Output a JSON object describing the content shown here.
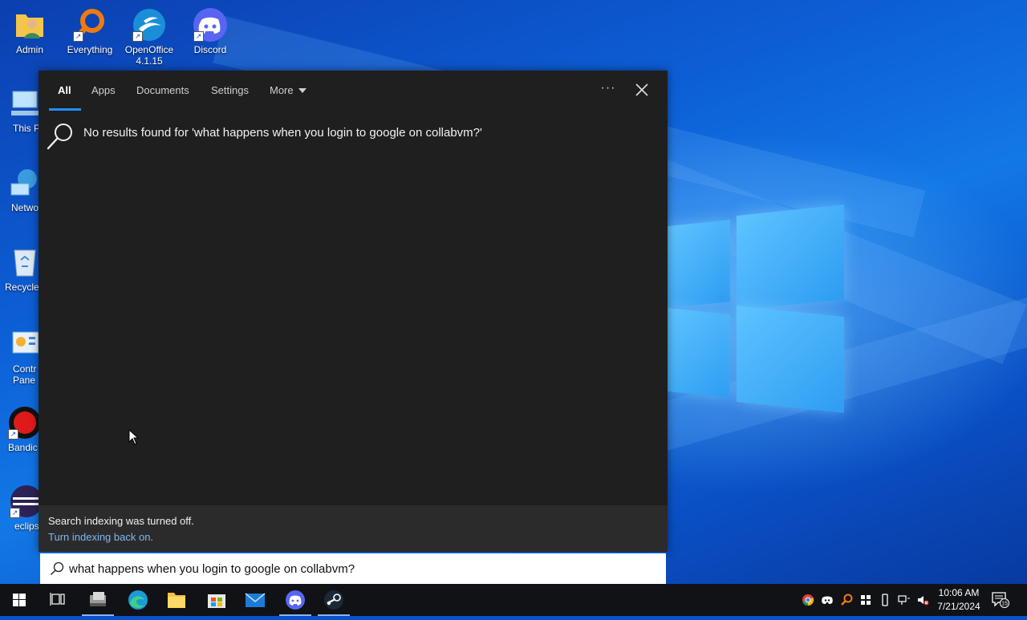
{
  "desktop": {
    "icons": [
      {
        "label": "Admin"
      },
      {
        "label": "Everything"
      },
      {
        "label": "OpenOffice\n4.1.15"
      },
      {
        "label": "Discord"
      },
      {
        "label": "This P"
      },
      {
        "label": "Netwo"
      },
      {
        "label": "Recycle"
      },
      {
        "label": "Contr\nPane"
      },
      {
        "label": "Bandic"
      },
      {
        "label": "eclips"
      }
    ]
  },
  "search": {
    "tabs": [
      {
        "label": "All"
      },
      {
        "label": "Apps"
      },
      {
        "label": "Documents"
      },
      {
        "label": "Settings"
      },
      {
        "label": "More"
      }
    ],
    "ellipsis": "···",
    "no_results": "No results found for 'what happens when you login to google on collabvm?'",
    "indexing_message": "Search indexing was turned off.",
    "indexing_link": "Turn indexing back on.",
    "query": "what happens when you login to google on collabvm?"
  },
  "taskbar": {
    "time": "10:06 AM",
    "date": "7/21/2024",
    "notification_count": "15"
  },
  "colors": {
    "accent": "#1f8fff",
    "panel_bg": "#1f1f1f",
    "link": "#7fb7f0"
  }
}
